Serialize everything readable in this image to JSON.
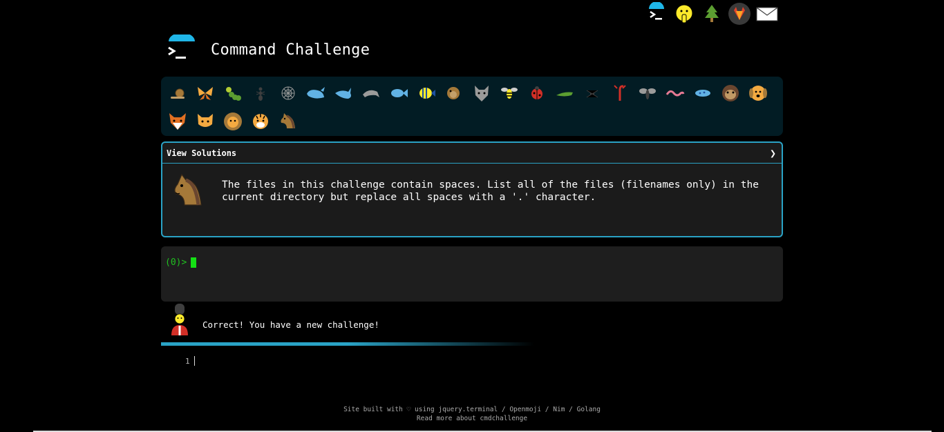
{
  "header": {
    "title": "Command Challenge"
  },
  "top_icons": [
    "terminal-icon",
    "shush-face-icon",
    "tree-icon",
    "gitlab-icon",
    "envelope-icon"
  ],
  "animals": {
    "row1": [
      "snail",
      "butterfly",
      "caterpillar",
      "ant",
      "spider-web",
      "whale",
      "shark",
      "dolphin",
      "fish",
      "tropical-fish",
      "blowfish",
      "wolf",
      "bee",
      "ladybug",
      "cricket",
      "spider",
      "scorpion",
      "mosquito",
      "worm",
      "microbe",
      "monkey",
      "dog"
    ],
    "row2": [
      "fox",
      "cat",
      "lion",
      "tiger",
      "horse"
    ]
  },
  "challenge": {
    "view_solutions_label": "View Solutions",
    "arrow": "❯",
    "text": "The files in this challenge contain spaces. List all of the files (filenames only) in the current directory but replace all spaces with a '.' character."
  },
  "terminal": {
    "prompt": "(0)>"
  },
  "result": {
    "message": "Correct! You have a new challenge!"
  },
  "editor": {
    "line_number": "1"
  },
  "footer": {
    "prefix": "Site built with ♡ using ",
    "links": [
      "jquery.terminal",
      "Openmoji",
      "Nim",
      "Golang"
    ],
    "separator": " / ",
    "read_more": "Read more about cmdchallenge"
  },
  "colors": {
    "accent": "#2aa3c6",
    "prompt_green": "#20c020",
    "panel_bg": "#021c24"
  }
}
